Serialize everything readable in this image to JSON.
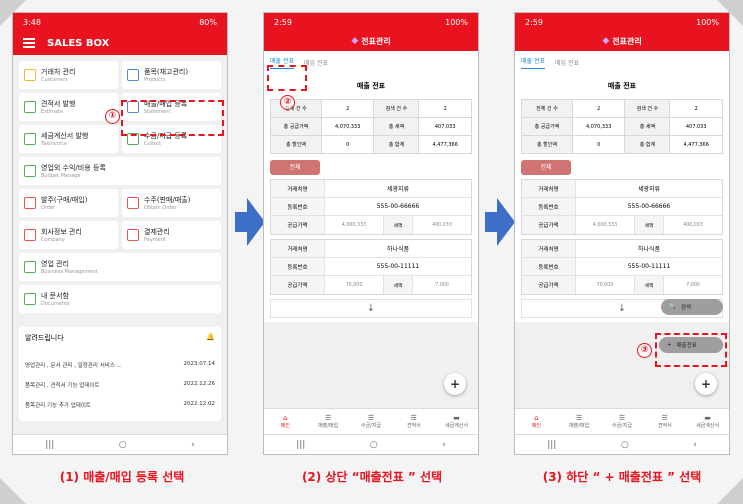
{
  "status1": {
    "time": "3:48",
    "battery": "80%"
  },
  "status2": {
    "time": "2:59",
    "battery": "100%"
  },
  "app": {
    "title": "SALES BOX",
    "menu": [
      {
        "t": "거래처 관리",
        "s": "Customers",
        "color": "#f2b23b"
      },
      {
        "t": "품목(재고관리)",
        "s": "Products",
        "color": "#4e88d9"
      },
      {
        "t": "견적서 발행",
        "s": "Estimate",
        "color": "#4cae5b"
      },
      {
        "t": "매출/매입 등록",
        "s": "Statement",
        "color": "#4e88d9"
      },
      {
        "t": "세금계산서 발행",
        "s": "Taxinvoice",
        "color": "#4cae5b"
      },
      {
        "t": "수금/지급 등록",
        "s": "Collect",
        "color": "#4cae5b"
      },
      {
        "t": "영업외 수익/비용 등록",
        "s": "Budget Manage",
        "color": "#4cae5b"
      },
      {
        "t": "발주(구매/매입)",
        "s": "Order",
        "color": "#e8554f"
      },
      {
        "t": "수주(판매/매출)",
        "s": "Obtain Order",
        "color": "#e8554f"
      },
      {
        "t": "회사정보 관리",
        "s": "Company",
        "color": "#e8554f"
      },
      {
        "t": "결제관리",
        "s": "Payment",
        "color": "#e8554f"
      },
      {
        "t": "영업 관리",
        "s": "Business Management",
        "color": "#4cae5b"
      },
      {
        "t": "내 문서함",
        "s": "Documents",
        "color": "#4cae5b"
      }
    ],
    "notice_title": "알려드립니다",
    "notices": [
      {
        "t": "영업관리 , 문서 관리 , 일정관리 서비스 ...",
        "d": "2023.07.14"
      },
      {
        "t": "품목관리 , 견적서 기능 업데이트",
        "d": "2022.12.26"
      },
      {
        "t": "품목관리 기능 추가 업데이트",
        "d": "2022.12.02"
      }
    ]
  },
  "statement": {
    "header": "전표관리",
    "tab_sales": "매출 전표",
    "tab_purchase": "매입 전표",
    "title": "매출 전표",
    "summary": [
      [
        "전체 건 수",
        "2",
        "검색 건 수",
        "2"
      ],
      [
        "총 공급가액",
        "4,070,333",
        "총 세액",
        "407,033"
      ],
      [
        "총 할인액",
        "0",
        "총 합계",
        "4,477,366"
      ]
    ],
    "all_button": "전체",
    "items": [
      {
        "name_label": "거래처명",
        "name": "세광지류",
        "reg_label": "등록번호",
        "reg": "555-00-66666",
        "supply_label": "공급가액",
        "supply": "4,000,333",
        "tax_label": "세액",
        "tax": "400,033"
      },
      {
        "name_label": "거래처명",
        "name": "하나식품",
        "reg_label": "등록번호",
        "reg": "555-00-11111",
        "supply_label": "공급가액",
        "supply": "70,000",
        "tax_label": "세액",
        "tax": "7,000"
      }
    ],
    "fab": "+",
    "search_label": "검색",
    "add_label": "매출전표",
    "bottom_nav": [
      "메인",
      "매출/매입",
      "수금/지급",
      "견적서",
      "세금계산서"
    ]
  },
  "markers": [
    "①",
    "②",
    "③"
  ],
  "captions": [
    "(1) 매출/매입 등록 선택",
    "(2) 상단 “매출전표 ” 선택",
    "(3) 하단 “ + 매출전표 ” 선택"
  ]
}
